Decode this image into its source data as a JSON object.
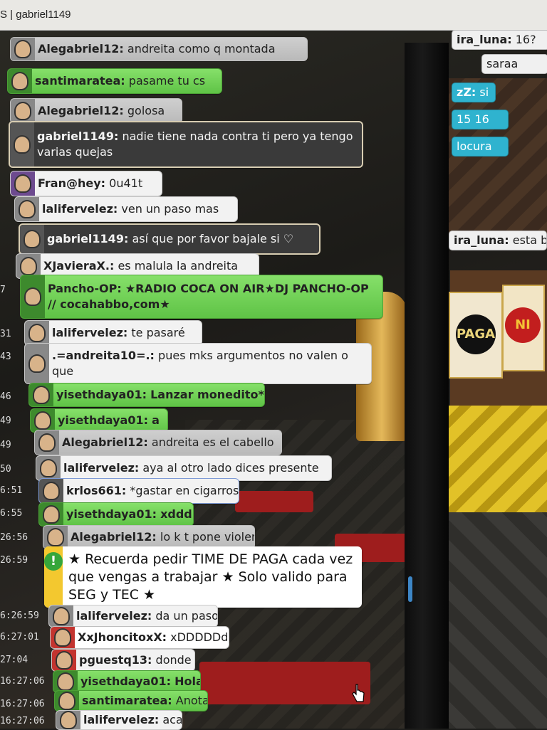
{
  "window": {
    "title": "S | gabriel1149"
  },
  "timestamps": [
    "7",
    "31",
    "43",
    "46",
    "49",
    "49",
    "50",
    "6:51",
    "6:55",
    "26:56",
    "26:59",
    "6:26:59",
    "6:27:01",
    "27:04",
    "16:27:06",
    "16:27:06",
    "16:27:06"
  ],
  "chat": [
    {
      "user": "Alegabriel12:",
      "text": "andreita como q montada",
      "style": "gray"
    },
    {
      "user": "santimaratea:",
      "text": "pasame tu cs",
      "style": "green"
    },
    {
      "user": "Alegabriel12:",
      "text": "golosa",
      "style": "gray"
    },
    {
      "user": "gabriel1149:",
      "text": "nadie tiene nada contra ti pero ya tengo varias quejas",
      "style": "dark"
    },
    {
      "user": "Fran@hey:",
      "text": "0u41t",
      "style": "white"
    },
    {
      "user": "lalifervelez:",
      "text": "ven un paso mas",
      "style": "white"
    },
    {
      "user": "gabriel1149:",
      "text": "así que por favor bajale si ♡",
      "style": "dark"
    },
    {
      "user": "XJavieraX.:",
      "text": "es malula la andreita",
      "style": "white"
    },
    {
      "user": "Pancho-OP:",
      "text": "★RADIO COCA ON AIR★DJ PANCHO-OP // cocahabbo,com★",
      "style": "green"
    },
    {
      "user": "lalifervelez:",
      "text": "te pasaré",
      "style": "white"
    },
    {
      "user": ".=andreita10=.:",
      "text": "pues  mks argumentos no valen o que",
      "style": "white"
    },
    {
      "user": "yisethdaya01:",
      "text": "Lanzar monedito*",
      "style": "green"
    },
    {
      "user": "yisethdaya01:",
      "text": "a",
      "style": "green"
    },
    {
      "user": "Alegabriel12:",
      "text": "andreita es el cabello",
      "style": "gray"
    },
    {
      "user": "lalifervelez:",
      "text": "aya al otro lado dices presente",
      "style": "white"
    },
    {
      "user": "krlos661:",
      "text": "*gastar en cigarros",
      "style": "white"
    },
    {
      "user": "yisethdaya01:",
      "text": "xddd",
      "style": "green"
    },
    {
      "user": "Alegabriel12:",
      "text": "lo k t pone violenta",
      "style": "gray"
    },
    {
      "user": "lalifervelez:",
      "text": "da un paso",
      "style": "white"
    },
    {
      "user": "XxJhoncitoxX:",
      "text": "xDDDDDd",
      "style": "red"
    },
    {
      "user": "pguestq13:",
      "text": "donde",
      "style": "white"
    },
    {
      "user": "yisethdaya01:",
      "text": "Hola",
      "style": "green"
    },
    {
      "user": "santimaratea:",
      "text": "Anota:",
      "style": "green"
    },
    {
      "user": "lalifervelez:",
      "text": "aca",
      "style": "white"
    }
  ],
  "notice": {
    "icon": "!",
    "text": "★ Recuerda pedir TIME DE PAGA cada vez que vengas a trabajar ★ Solo valido para SEG y TEC ★"
  },
  "right_chat": [
    {
      "user": "ira_luna:",
      "text": "16?"
    },
    {
      "user": "",
      "text": "saraa"
    },
    {
      "user": "zZ:",
      "text": "si"
    },
    {
      "user": "",
      "text": "15 16"
    },
    {
      "user": "",
      "text": "locura"
    },
    {
      "user": "ira_luna:",
      "text": "esta bien c"
    }
  ],
  "banners": [
    "PAGA",
    "NI"
  ]
}
